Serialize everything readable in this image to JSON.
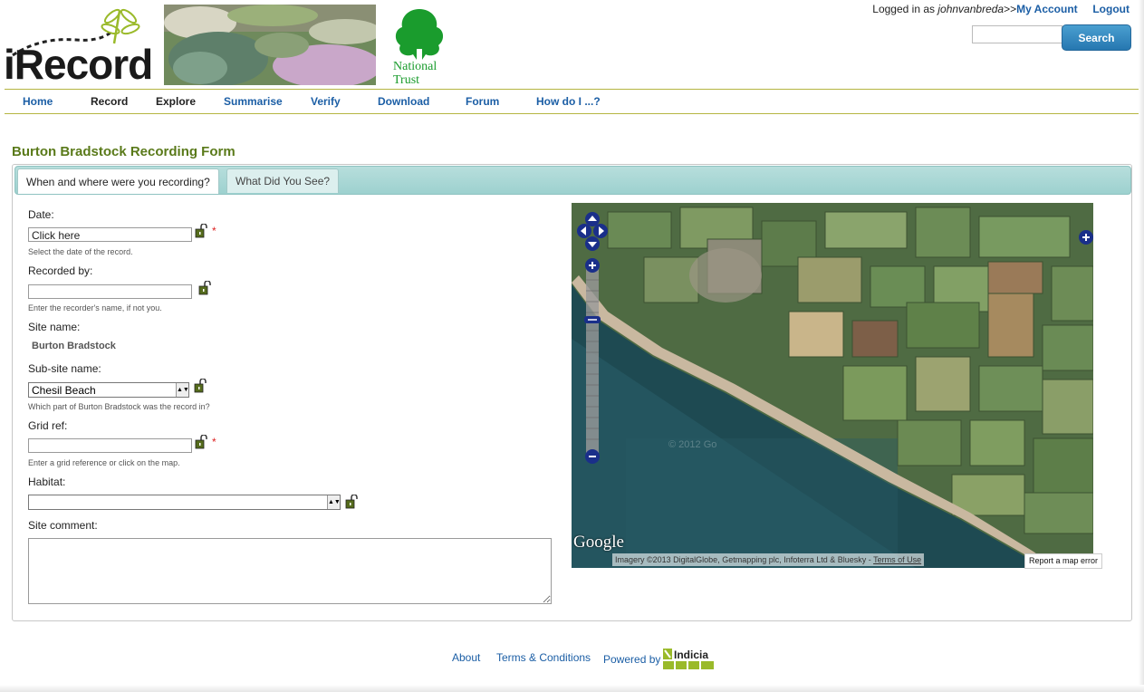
{
  "brand": {
    "logo_text": "iRecord",
    "partner_name": "National Trust"
  },
  "session": {
    "prefix": "Logged in as",
    "username": "johnvanbreda",
    "separator": ">>",
    "my_account": "My Account",
    "logout": "Logout"
  },
  "search": {
    "placeholder": "",
    "button_label": "Search"
  },
  "nav": {
    "items": [
      {
        "label": "Home"
      },
      {
        "label": "Record"
      },
      {
        "label": "Explore"
      },
      {
        "label": "Summarise"
      },
      {
        "label": "Verify"
      },
      {
        "label": "Download"
      },
      {
        "label": "Forum"
      },
      {
        "label": "How do I ...?"
      }
    ]
  },
  "form": {
    "title": "Burton Bradstock Recording Form",
    "tabs": [
      {
        "label": "When and where were you recording?",
        "active": true
      },
      {
        "label": "What Did You See?",
        "active": false
      }
    ],
    "date": {
      "label": "Date:",
      "value": "Click here",
      "hint": "Select the date of the record.",
      "required": "*"
    },
    "recorded_by": {
      "label": "Recorded by:",
      "value": "",
      "hint": "Enter the recorder's name, if not you."
    },
    "site_name": {
      "label": "Site name:",
      "value": "Burton Bradstock"
    },
    "sub_site": {
      "label": "Sub-site name:",
      "selected": "Chesil Beach",
      "hint": "Which part of Burton Bradstock was the record in?"
    },
    "grid_ref": {
      "label": "Grid ref:",
      "value": "",
      "hint": "Enter a grid reference or click on the map.",
      "required": "*"
    },
    "habitat": {
      "label": "Habitat:",
      "selected": ""
    },
    "site_comment": {
      "label": "Site comment:",
      "value": ""
    }
  },
  "map": {
    "provider": "Google",
    "attribution": "Imagery ©2013 DigitalGlobe, Getmapping plc, Infoterra Ltd & Bluesky -",
    "terms": "Terms of Use",
    "report": "Report a map error",
    "watermark": "© 2012 Go"
  },
  "footer": {
    "about": "About",
    "terms": "Terms & Conditions",
    "powered_by": "Powered by",
    "indicia": "Indicia"
  },
  "colors": {
    "link": "#1b5ea5",
    "title_green": "#5a7a1a",
    "tab_bar": "#a8d6d4",
    "search_button": "#2f84bd",
    "required": "#dd2222"
  }
}
